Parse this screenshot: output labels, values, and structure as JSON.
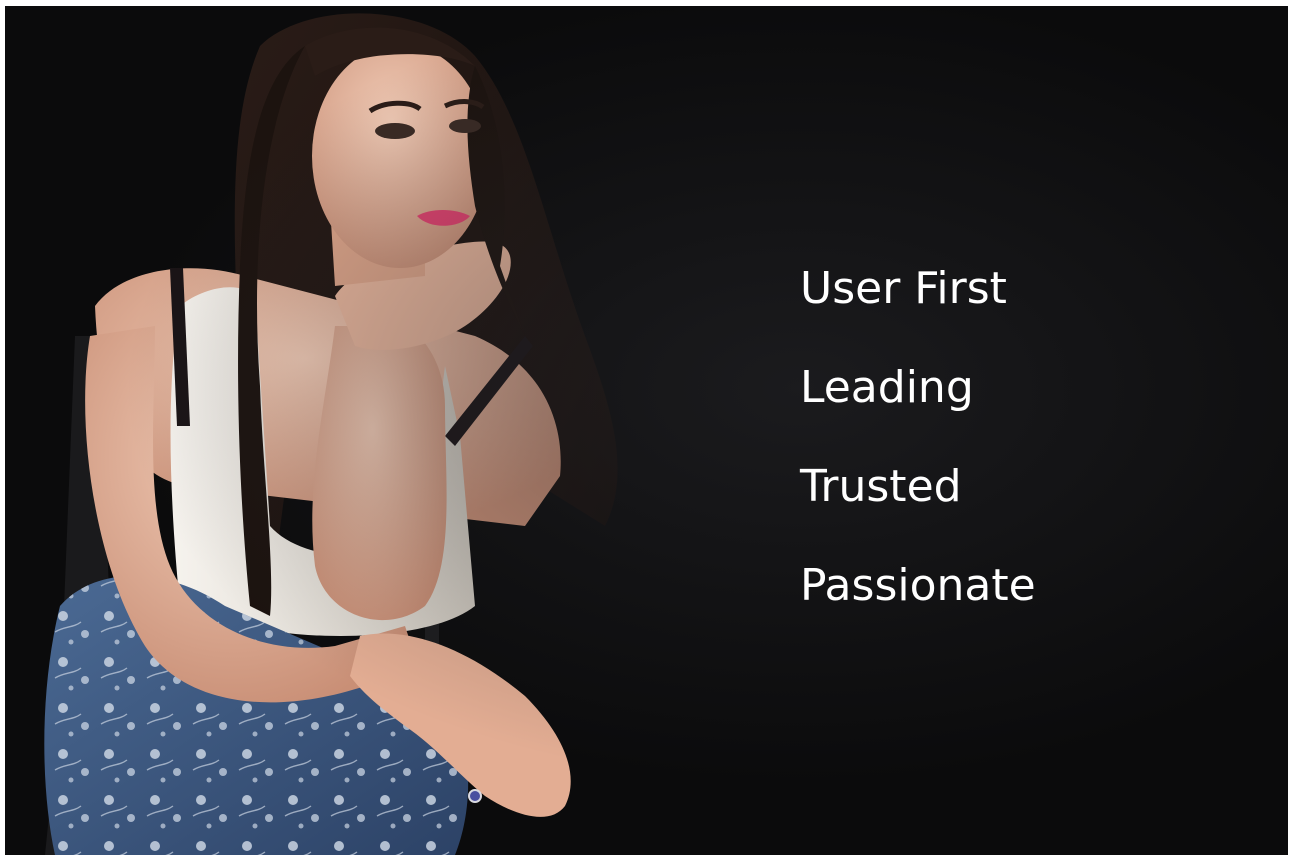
{
  "colors": {
    "background": "#0b0b0c",
    "text": "#ffffff",
    "hair": "#1e1512",
    "skin": "#e8b9a1",
    "top": "#efebe4",
    "jeans": "#3a557d",
    "lips": "#e0426f"
  },
  "photo": {
    "subject": "woman-portrait-photo"
  },
  "values": [
    {
      "label": "User First"
    },
    {
      "label": "Leading"
    },
    {
      "label": "Trusted"
    },
    {
      "label": "Passionate"
    }
  ]
}
